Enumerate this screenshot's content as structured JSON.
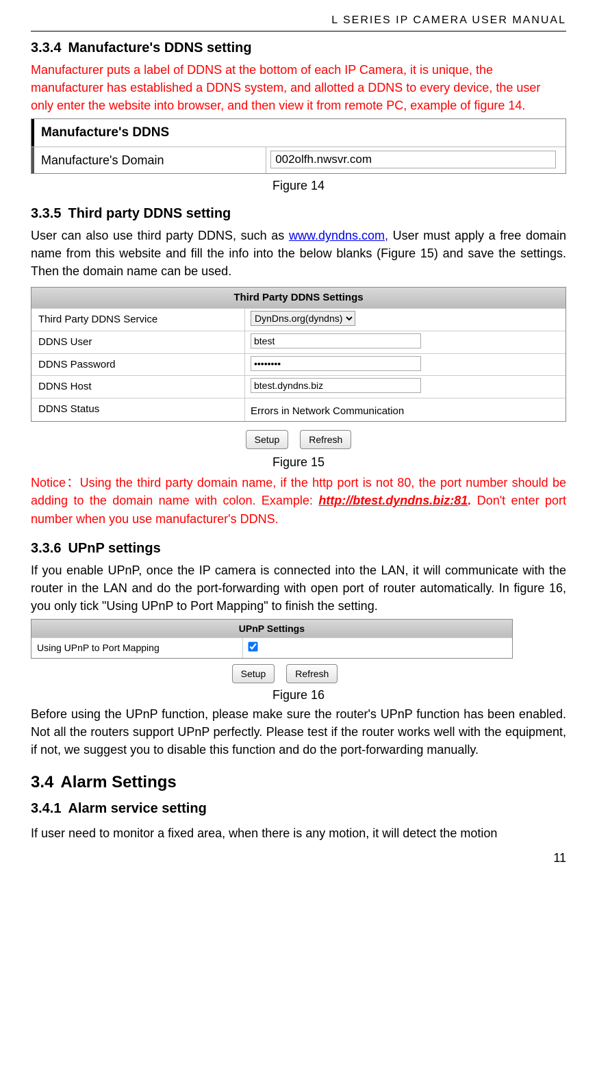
{
  "header": {
    "running": "L  SERIES  IP  CAMERA  USER  MANUAL"
  },
  "s334": {
    "num": "3.3.4",
    "title": "Manufacture's DDNS setting",
    "para": "Manufacturer puts a label of DDNS at the bottom of each IP Camera, it is unique, the manufacturer has established a DDNS system, and allotted a DDNS to every device, the user only enter the website into browser, and then view it from remote PC, example of figure 14."
  },
  "fig14": {
    "boxtitle": "Manufacture's DDNS",
    "label": "Manufacture's Domain",
    "value": "002olfh.nwsvr.com",
    "caption": "Figure 14"
  },
  "s335": {
    "num": "3.3.5",
    "title": "Third party DDNS setting",
    "para_a": "User can also use third party DDNS, such as ",
    "link": "www.dyndns.com,",
    "para_b": " User must apply a free domain name from this website and fill the info into the below blanks (Figure 15) and save the settings. Then the domain name can be used."
  },
  "fig15": {
    "title": "Third Party DDNS Settings",
    "rows": {
      "service_l": "Third Party DDNS Service",
      "service_v": "DynDns.org(dyndns)",
      "user_l": "DDNS User",
      "user_v": "btest",
      "pass_l": "DDNS Password",
      "pass_v": "••••••••",
      "host_l": "DDNS Host",
      "host_v": "btest.dyndns.biz",
      "status_l": "DDNS Status",
      "status_v": "Errors in Network Communication"
    },
    "btn_setup": "Setup",
    "btn_refresh": "Refresh",
    "caption": "Figure 15"
  },
  "notice": {
    "a": "Notice：Using the third party domain name, if the http port is not 80, the port number should be adding to the domain name with colon. Example: ",
    "link": "http://btest.dyndns.biz:81",
    "dot": ".",
    "b": " Don't enter port number when you use manufacturer's DDNS."
  },
  "s336": {
    "num": "3.3.6",
    "title": "UPnP settings",
    "para": "If you enable UPnP, once the IP camera is connected into the LAN, it will communicate with the router in the LAN and do the port-forwarding with open port of router automatically. In figure 16, you only tick \"Using UPnP to Port Mapping\" to finish the setting."
  },
  "fig16": {
    "title": "UPnP Settings",
    "label": "Using UPnP to Port Mapping",
    "btn_setup": "Setup",
    "btn_refresh": "Refresh",
    "caption": "Figure 16"
  },
  "upnp_para2": "Before using the UPnP function, please make sure the router's UPnP function has been enabled. Not all the routers support UPnP perfectly. Please test if the router works well with the equipment, if not, we suggest you to disable this function and do the port-forwarding manually.",
  "s34": {
    "num": "3.4",
    "title": "Alarm Settings"
  },
  "s341": {
    "num": "3.4.1",
    "title": "Alarm service setting",
    "para": "If user need to monitor a fixed area, when there is any motion, it will detect the motion"
  },
  "pagenum": "11"
}
